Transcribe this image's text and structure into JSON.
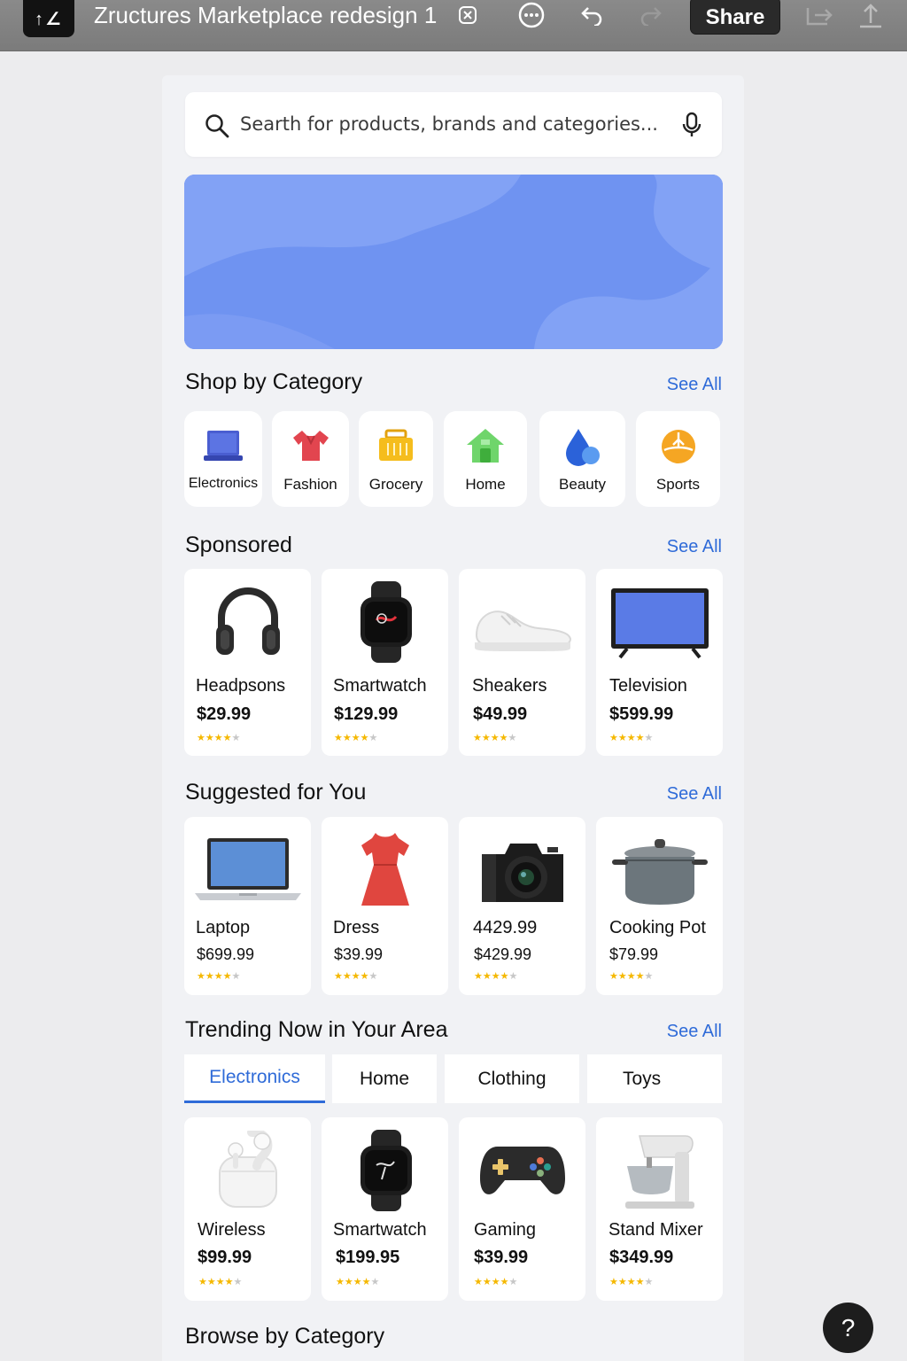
{
  "toolbar": {
    "logo_text": "↑∠",
    "title": "Zructures Marketplace redesign 1",
    "share_label": "Share",
    "icons": [
      "rename-icon",
      "more-icon",
      "undo-icon",
      "redo-icon",
      "export-icon",
      "upload-icon"
    ]
  },
  "search": {
    "placeholder": "Searth for products, brands and categories..."
  },
  "banner": {
    "colors": [
      "#6f93f1",
      "#82a2f5"
    ]
  },
  "categories_section": {
    "title": "Shop by Category",
    "see_all": "See All",
    "items": [
      {
        "label": "Electronics",
        "icon": "laptop-icon"
      },
      {
        "label": "Fashion",
        "icon": "shirt-icon"
      },
      {
        "label": "Grocery",
        "icon": "basket-icon"
      },
      {
        "label": "Home",
        "icon": "house-icon"
      },
      {
        "label": "Beauty",
        "icon": "drop-icon"
      },
      {
        "label": "Sports",
        "icon": "ball-icon"
      }
    ]
  },
  "sponsored": {
    "title": "Sponsored",
    "see_all": "See All",
    "items": [
      {
        "name": "Headpsons",
        "price": "$29.99",
        "rating": 4,
        "image": "headphones"
      },
      {
        "name": "Smartwatch",
        "price": "$129.99",
        "rating": 4,
        "image": "smartwatch"
      },
      {
        "name": "Sheakers",
        "price": "$49.99",
        "rating": 4,
        "image": "sneaker"
      },
      {
        "name": "Television",
        "price": "$599.99",
        "rating": 4,
        "image": "television"
      }
    ]
  },
  "suggested": {
    "title": "Suggested for You",
    "see_all": "See All",
    "items": [
      {
        "name": "Laptop",
        "price": "$699.99",
        "rating": 4,
        "image": "laptop"
      },
      {
        "name": "Dress",
        "price": "$39.99",
        "rating": 4,
        "image": "dress"
      },
      {
        "name": "4429.99",
        "price": "$429.99",
        "rating": 4,
        "image": "camera"
      },
      {
        "name": "Cooking Pot",
        "price": "$79.99",
        "rating": 4,
        "image": "pot"
      }
    ]
  },
  "trending": {
    "title": "Trending Now in Your Area",
    "see_all": "See All",
    "tabs": [
      {
        "label": "Electronics",
        "active": true
      },
      {
        "label": "Home",
        "active": false
      },
      {
        "label": "Clothing",
        "active": false
      },
      {
        "label": "Toys",
        "active": false
      }
    ],
    "items": [
      {
        "name": "Wireless",
        "price": "$99.99",
        "rating": 4,
        "image": "earbuds"
      },
      {
        "name": "Smartwatch",
        "price": "$199.95",
        "rating": 4,
        "image": "smartwatch"
      },
      {
        "name": "Gaming",
        "price": "$39.99",
        "rating": 4,
        "image": "gamepad"
      },
      {
        "name": "Stand Mixer",
        "price": "$349.99",
        "rating": 4,
        "image": "mixer"
      }
    ]
  },
  "browse": {
    "title": "Browse by Category"
  },
  "help": {
    "label": "?"
  },
  "colors": {
    "accent": "#2f6bd8",
    "star": "#f5b800",
    "banner": "#6f93f1"
  }
}
